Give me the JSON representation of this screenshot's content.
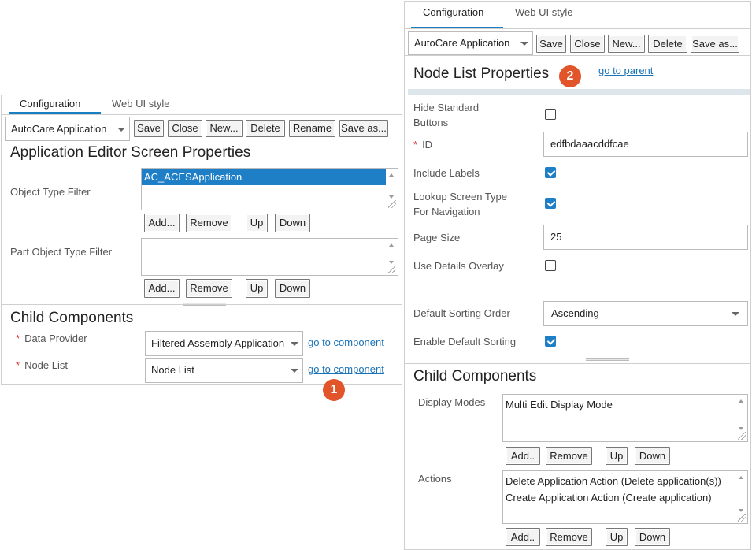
{
  "left": {
    "tabs": [
      {
        "label": "Configuration"
      },
      {
        "label": "Web UI style"
      }
    ],
    "toolbar": {
      "selector_value": "AutoCare Application",
      "save": "Save",
      "close": "Close",
      "new": "New...",
      "delete": "Delete",
      "rename": "Rename",
      "save_as": "Save as..."
    },
    "title": "Application Editor Screen Properties",
    "object_type_filter": {
      "label": "Object Type Filter",
      "items": [
        "AC_ACESApplication"
      ],
      "add": "Add...",
      "remove": "Remove",
      "up": "Up",
      "down": "Down"
    },
    "part_object_type_filter": {
      "label": "Part Object Type Filter",
      "items": [],
      "add": "Add...",
      "remove": "Remove",
      "up": "Up",
      "down": "Down"
    },
    "child_components": {
      "title": "Child Components",
      "required_mark": "*",
      "data_provider": {
        "label": "Data Provider",
        "value": "Filtered Assembly Application",
        "link": "go to component"
      },
      "node_list": {
        "label": "Node List",
        "value": "Node List",
        "link": "go to component"
      }
    },
    "badge": "1",
    "accent_color": "#1e7fc7"
  },
  "right": {
    "tabs": [
      {
        "label": "Configuration"
      },
      {
        "label": "Web UI style"
      }
    ],
    "toolbar": {
      "selector_value": "AutoCare Application",
      "save": "Save",
      "close": "Close",
      "new": "New...",
      "delete": "Delete",
      "save_as": "Save as..."
    },
    "title": "Node List Properties",
    "badge": "2",
    "parent_link": "go to parent",
    "fields": {
      "hide_standard_buttons": {
        "label": "Hide Standard Buttons",
        "checked": false
      },
      "id": {
        "label": "ID",
        "required_mark": "*",
        "value": "edfbdaaacddfcae"
      },
      "include_labels": {
        "label": "Include Labels",
        "checked": true
      },
      "lookup_screen_type": {
        "label": "Lookup Screen Type For Navigation",
        "checked": true
      },
      "page_size": {
        "label": "Page Size",
        "value": "25"
      },
      "use_details_overlay": {
        "label": "Use Details Overlay",
        "checked": false
      },
      "default_sorting_order": {
        "label": "Default Sorting Order",
        "value": "Ascending"
      },
      "enable_default_sorting": {
        "label": "Enable Default Sorting",
        "checked": true
      }
    },
    "child_components": {
      "title": "Child Components",
      "display_modes": {
        "label": "Display Modes",
        "items": [
          "Multi Edit Display Mode"
        ],
        "add": "Add..",
        "remove": "Remove",
        "up": "Up",
        "down": "Down"
      },
      "actions": {
        "label": "Actions",
        "items": [
          "Delete Application Action (Delete application(s))",
          "Create Application Action (Create application)"
        ],
        "add": "Add..",
        "remove": "Remove",
        "up": "Up",
        "down": "Down"
      }
    },
    "badge_color": "#e2542a"
  }
}
